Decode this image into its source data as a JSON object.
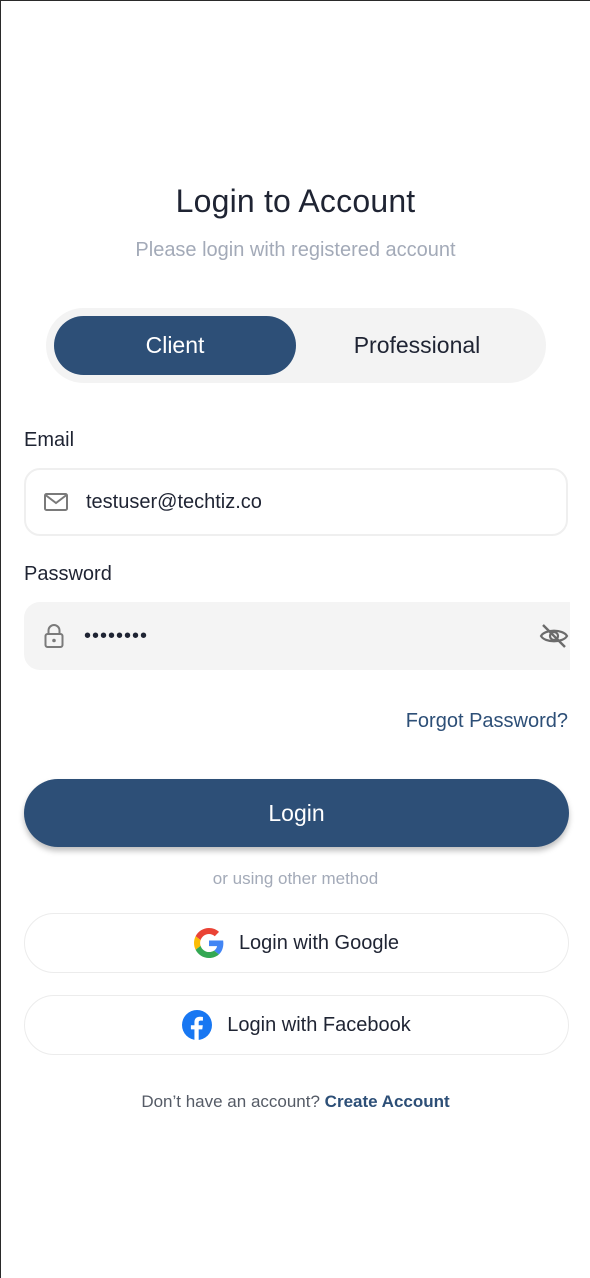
{
  "header": {
    "title": "Login to Account",
    "subtitle": "Please login with registered account"
  },
  "account_type": {
    "options": [
      "Client",
      "Professional"
    ],
    "selected": "Client"
  },
  "email": {
    "label": "Email",
    "value": "testuser@techtiz.co",
    "icon": "mail-icon"
  },
  "password": {
    "label": "Password",
    "value": "••••••••",
    "icon": "lock-icon",
    "toggle_icon": "eye-off-icon"
  },
  "forgot_password": "Forgot Password?",
  "login_button": "Login",
  "divider_text": "or using other method",
  "social": {
    "google": {
      "label": "Login with Google",
      "icon": "google-icon"
    },
    "facebook": {
      "label": "Login with Facebook",
      "icon": "facebook-icon"
    }
  },
  "signup": {
    "prompt": "Don’t have an account?",
    "link": "Create Account"
  },
  "colors": {
    "primary": "#2d4f77",
    "muted": "#a3aab8",
    "field_bg": "#f4f4f4"
  }
}
